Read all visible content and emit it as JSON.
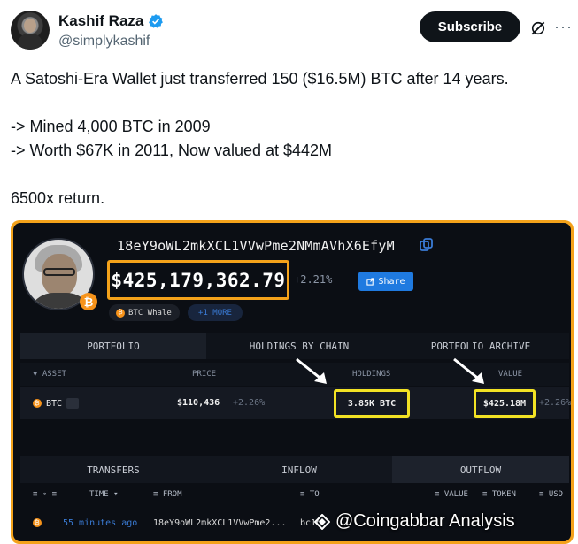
{
  "author": {
    "name": "Kashif Raza",
    "handle": "@simplykashif",
    "verified_color": "#1d9bf0"
  },
  "header": {
    "subscribe_label": "Subscribe",
    "more_label": "···"
  },
  "tweet": {
    "lines": [
      "A Satoshi-Era Wallet just transferred 150 ($16.5M) BTC after 14 years.",
      "",
      "-> Mined 4,000 BTC in 2009",
      "-> Worth $67K in 2011, Now valued at $442M",
      "",
      "6500x return."
    ]
  },
  "media": {
    "border_color": "#f4a21a",
    "btc_symbol": "₿",
    "address": "18eY9oWL2mkXCL1VVwPme2NMmAVhX6EfyM",
    "balance": "$425,179,362.79",
    "balance_change": "+2.21%",
    "share_label": "Share",
    "tags": {
      "whale": "BTC Whale",
      "more": "+1 MORE"
    },
    "tabs_top": [
      "PORTFOLIO",
      "HOLDINGS BY CHAIN",
      "PORTFOLIO ARCHIVE"
    ],
    "columns_top": {
      "asset": "▼ ASSET",
      "price": "PRICE",
      "holdings": "HOLDINGS",
      "value": "VALUE"
    },
    "holding_row": {
      "asset": "BTC",
      "price": "$110,436",
      "price_change": "+2.26%",
      "holdings": "3.85K BTC",
      "value": "$425.18M",
      "value_change": "+2.26%"
    },
    "tabs_bottom": [
      "TRANSFERS",
      "INFLOW",
      "OUTFLOW"
    ],
    "columns_bottom": {
      "filters": "≡ ∘ ≡",
      "time": "TIME ▾",
      "from": "≡ FROM",
      "to": "≡ TO",
      "value": "≡ VALUE",
      "token": "≡ TOKEN",
      "usd": "≡ USD"
    },
    "transfer_row": {
      "time": "55 minutes ago",
      "from": "18eY9oWL2mkXCL1VVwPme2...",
      "to": "bc1q"
    },
    "highlight_color": "#f2e224",
    "watermark": "@Coingabbar Analysis"
  }
}
